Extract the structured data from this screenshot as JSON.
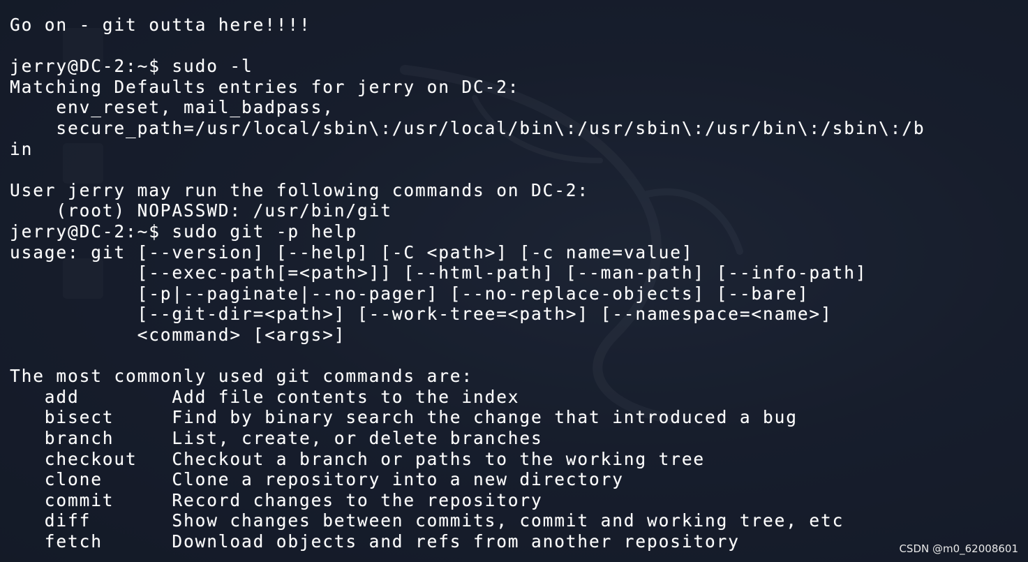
{
  "terminal": {
    "lines": [
      "Go on - git outta here!!!!",
      "",
      "jerry@DC-2:~$ sudo -l",
      "Matching Defaults entries for jerry on DC-2:",
      "    env_reset, mail_badpass,",
      "    secure_path=/usr/local/sbin\\:/usr/local/bin\\:/usr/sbin\\:/usr/bin\\:/sbin\\:/b",
      "in",
      "",
      "User jerry may run the following commands on DC-2:",
      "    (root) NOPASSWD: /usr/bin/git",
      "jerry@DC-2:~$ sudo git -p help",
      "usage: git [--version] [--help] [-C <path>] [-c name=value]",
      "           [--exec-path[=<path>]] [--html-path] [--man-path] [--info-path]",
      "           [-p|--paginate|--no-pager] [--no-replace-objects] [--bare]",
      "           [--git-dir=<path>] [--work-tree=<path>] [--namespace=<name>]",
      "           <command> [<args>]",
      "",
      "The most commonly used git commands are:",
      "   add        Add file contents to the index",
      "   bisect     Find by binary search the change that introduced a bug",
      "   branch     List, create, or delete branches",
      "   checkout   Checkout a branch or paths to the working tree",
      "   clone      Clone a repository into a new directory",
      "   commit     Record changes to the repository",
      "   diff       Show changes between commits, commit and working tree, etc",
      "   fetch      Download objects and refs from another repository"
    ]
  },
  "watermark": "CSDN @m0_62008601",
  "colors": {
    "background": "#1b2333",
    "text": "#ffffff"
  }
}
